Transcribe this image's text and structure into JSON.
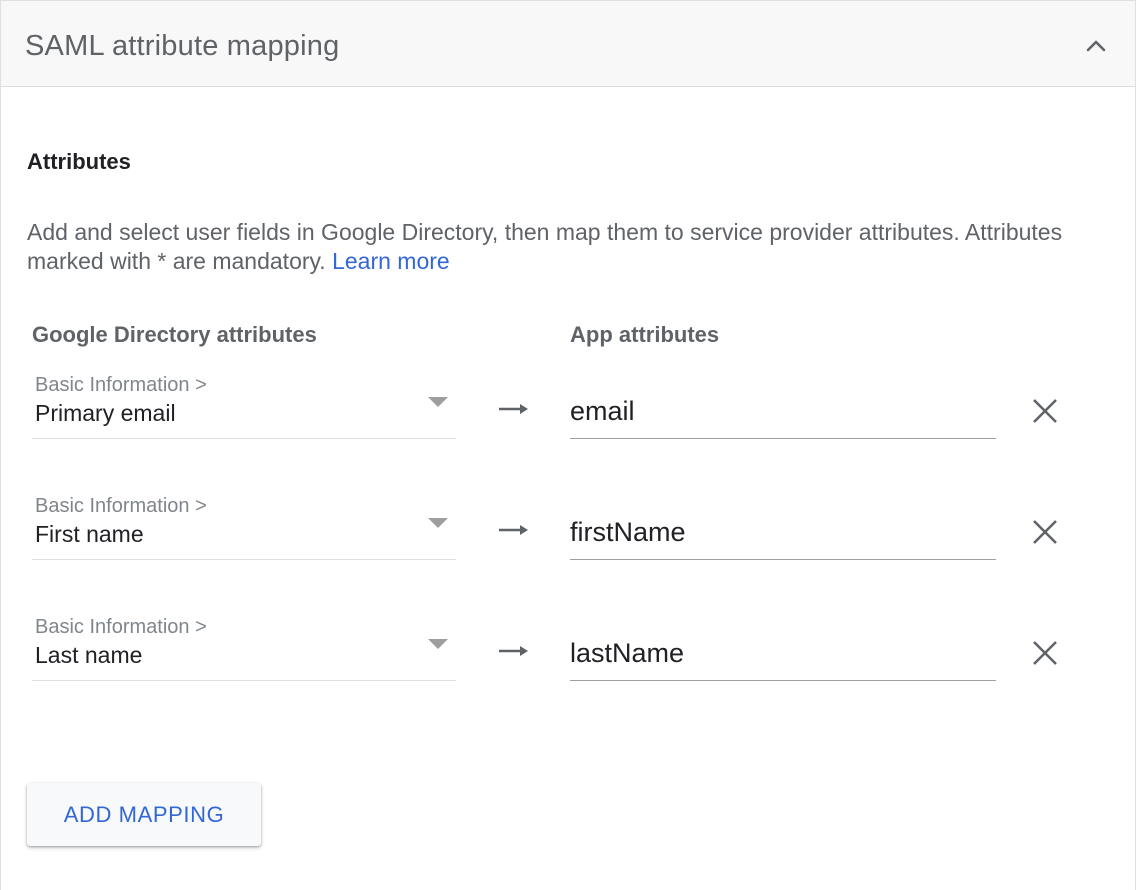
{
  "panel": {
    "title": "SAML attribute mapping"
  },
  "attributes": {
    "heading": "Attributes",
    "description": "Add and select user fields in Google Directory, then map them to service provider attributes. Attributes marked with * are mandatory.",
    "learn_more": "Learn more",
    "left_column_header": "Google Directory attributes",
    "right_column_header": "App attributes"
  },
  "mappings": [
    {
      "category": "Basic Information >",
      "field": "Primary email",
      "app_attribute": "email"
    },
    {
      "category": "Basic Information >",
      "field": "First name",
      "app_attribute": "firstName"
    },
    {
      "category": "Basic Information >",
      "field": "Last name",
      "app_attribute": "lastName"
    }
  ],
  "add_button": {
    "label": "ADD MAPPING"
  },
  "colors": {
    "accent": "#3367d6",
    "header_bg": "#f8f8f8",
    "text_primary": "#202124",
    "text_secondary": "#5f6368"
  },
  "icons": {
    "collapse": "chevron-up-icon",
    "dropdown": "dropdown-triangle-icon",
    "arrow": "arrow-right-icon",
    "remove": "close-icon"
  }
}
